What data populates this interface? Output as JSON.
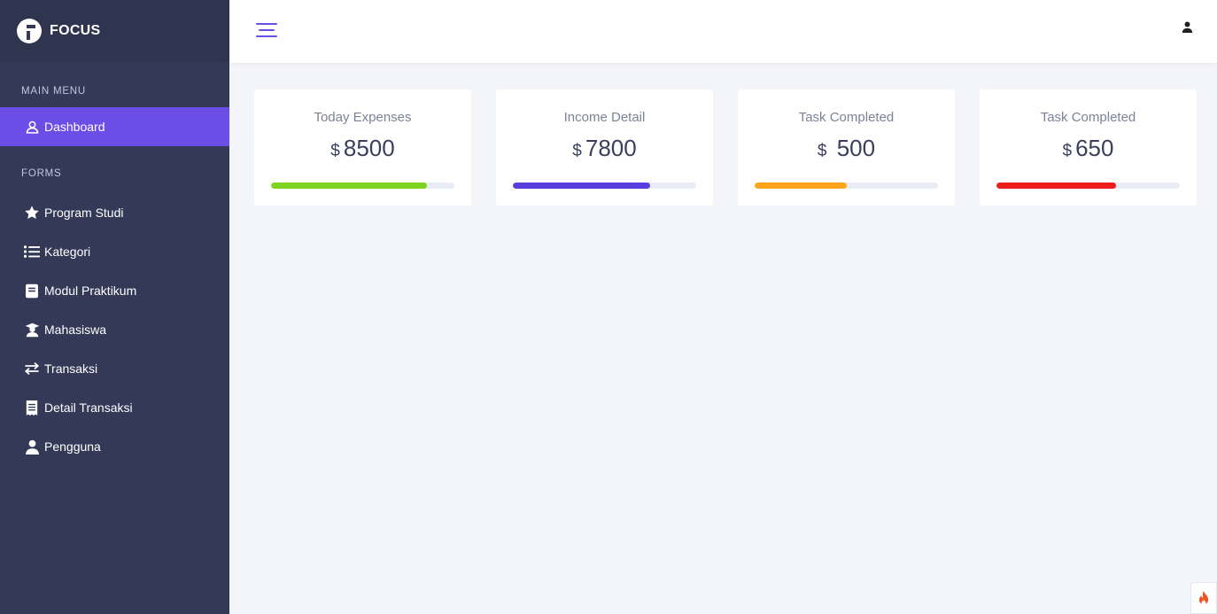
{
  "brand": {
    "name": "FOCUS",
    "logo_icon": "focus-logo-icon"
  },
  "sidebar": {
    "sections": {
      "main_menu": "MAIN MENU",
      "forms": "FORMS"
    },
    "main_items": [
      {
        "label": "Dashboard",
        "icon": "user-outline-icon",
        "active": true
      }
    ],
    "form_items": [
      {
        "label": "Program Studi",
        "icon": "star-icon"
      },
      {
        "label": "Kategori",
        "icon": "list-icon"
      },
      {
        "label": "Modul Praktikum",
        "icon": "book-icon"
      },
      {
        "label": "Mahasiswa",
        "icon": "graduate-icon"
      },
      {
        "label": "Transaksi",
        "icon": "exchange-icon"
      },
      {
        "label": "Detail Transaksi",
        "icon": "receipt-icon"
      },
      {
        "label": "Pengguna",
        "icon": "user-icon"
      }
    ]
  },
  "topbar": {
    "menu_icon": "hamburger-icon",
    "user_icon": "user-icon"
  },
  "cards": [
    {
      "title": "Today Expenses",
      "currency": "$",
      "value": "8500",
      "progress": 0.85,
      "color": "#7ed321"
    },
    {
      "title": "Income Detail",
      "currency": "$",
      "value": "7800",
      "progress": 0.75,
      "color": "#5a3ee0"
    },
    {
      "title": "Task Completed",
      "currency": "$",
      "value": " 500",
      "progress": 0.5,
      "color": "#ffa41b"
    },
    {
      "title": "Task Completed",
      "currency": "$",
      "value": "650",
      "progress": 0.65,
      "color": "#ef1c1c"
    }
  ],
  "colors": {
    "sidebar": "#343957",
    "accent": "#6b4ee6",
    "background": "#f4f5fa"
  },
  "floating_button": {
    "icon": "fire-icon"
  }
}
